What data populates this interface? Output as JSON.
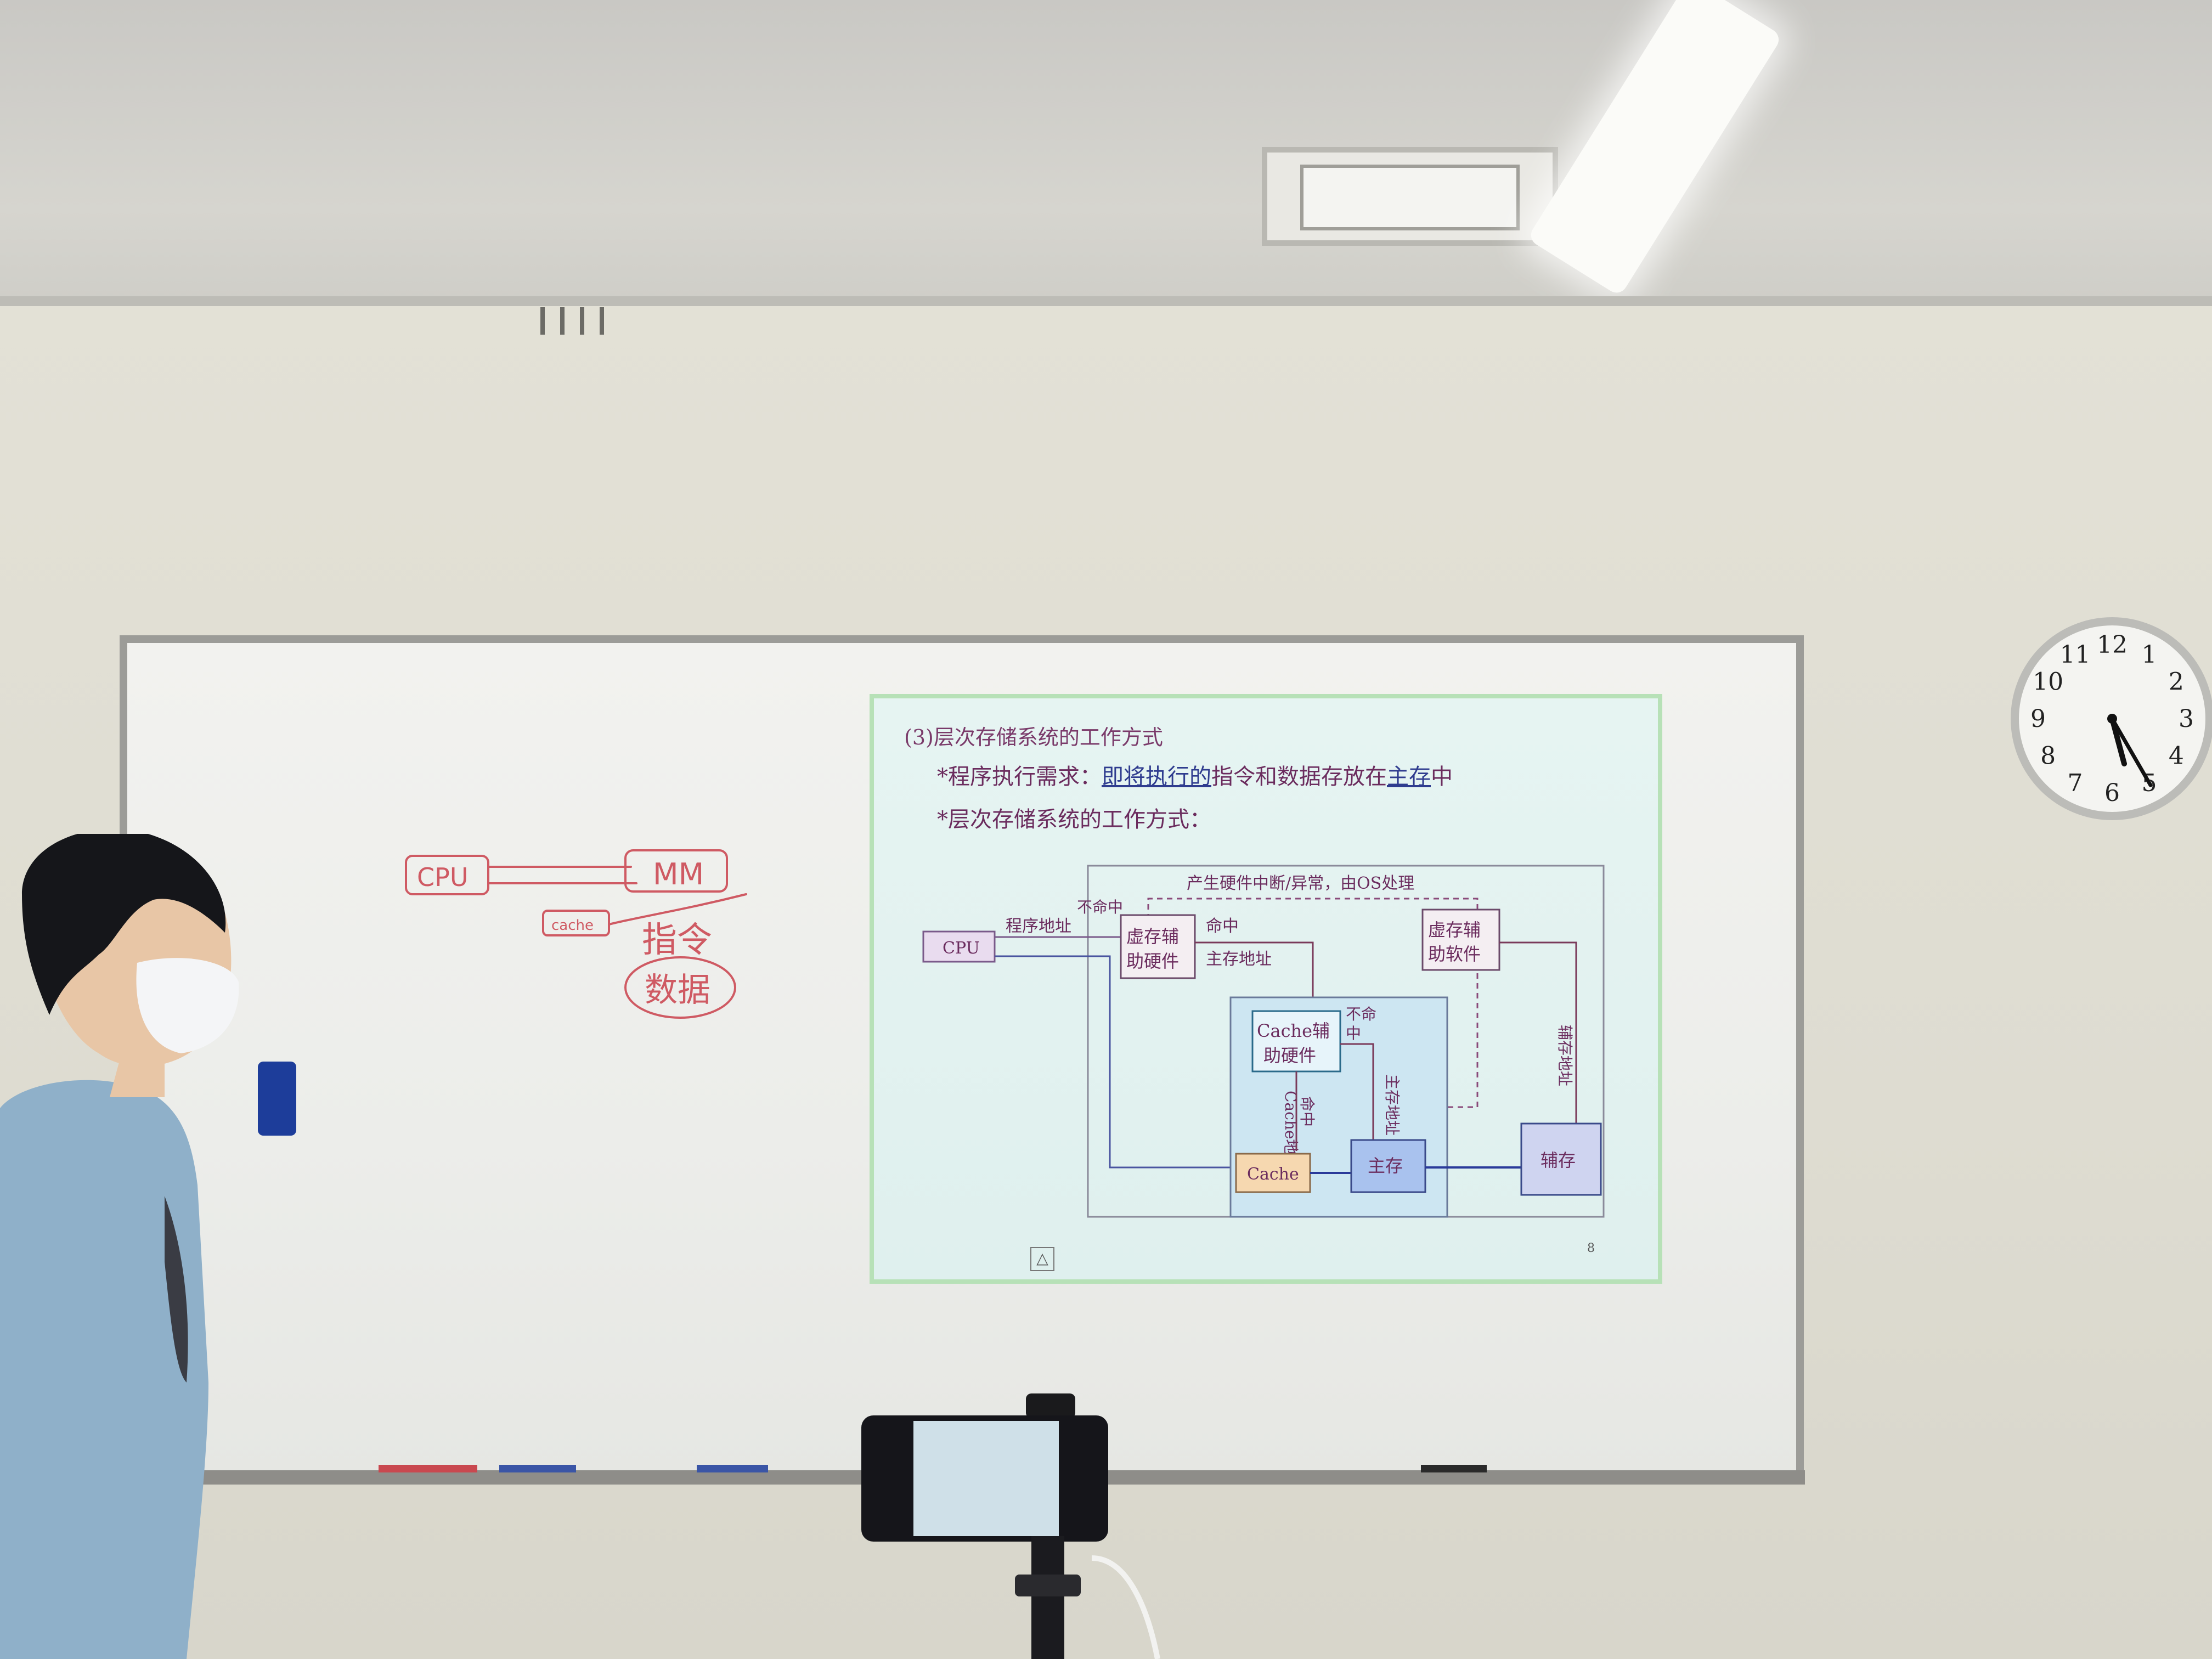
{
  "slide": {
    "title": "(3)层次存储系统的工作方式",
    "bullet1_prefix": "*程序执行需求：",
    "bullet1_link1": "即将执行的",
    "bullet1_middle": "指令和数据存放在",
    "bullet1_link2": "主存",
    "bullet1_suffix": "中",
    "bullet2": "*层次存储系统的工作方式：",
    "page_number": "8",
    "nav_icon": "△"
  },
  "diagram": {
    "top_label": "产生硬件中断/异常，由OS处理",
    "cpu": "CPU",
    "program_address": "程序地址",
    "miss_top": "不命中",
    "vm_hw_line1": "虚存辅",
    "vm_hw_line2": "助硬件",
    "hit": "命中",
    "main_address": "主存地址",
    "vm_sw_line1": "虚存辅",
    "vm_sw_line2": "助软件",
    "cache_hw_line1": "Cache辅",
    "cache_hw_line2": "助硬件",
    "miss_inner_1": "不命",
    "miss_inner_2": "中",
    "hit_vertical": "命中",
    "cache_address_vertical": "Cache地址",
    "main_address_vertical": "主存地址",
    "aux_address_vertical": "辅存地址",
    "cache": "Cache",
    "main_memory": "主存",
    "aux_memory": "辅存"
  },
  "whiteboard": {
    "note_cpu": "CPU",
    "note_mm": "MM",
    "note_cache": "cache",
    "note_instr": "指令",
    "note_data": "数据"
  },
  "clock": {
    "numbers": [
      "12",
      "1",
      "2",
      "3",
      "4",
      "5",
      "6",
      "7",
      "8",
      "9",
      "10",
      "11"
    ],
    "hour_hand_deg": 165,
    "minute_hand_deg": 150
  },
  "colors": {
    "slide_text": "#6b2c5e",
    "slide_link": "#2f3c8f",
    "marker_red": "#c9484f",
    "shirt": "#8fb0c9"
  }
}
